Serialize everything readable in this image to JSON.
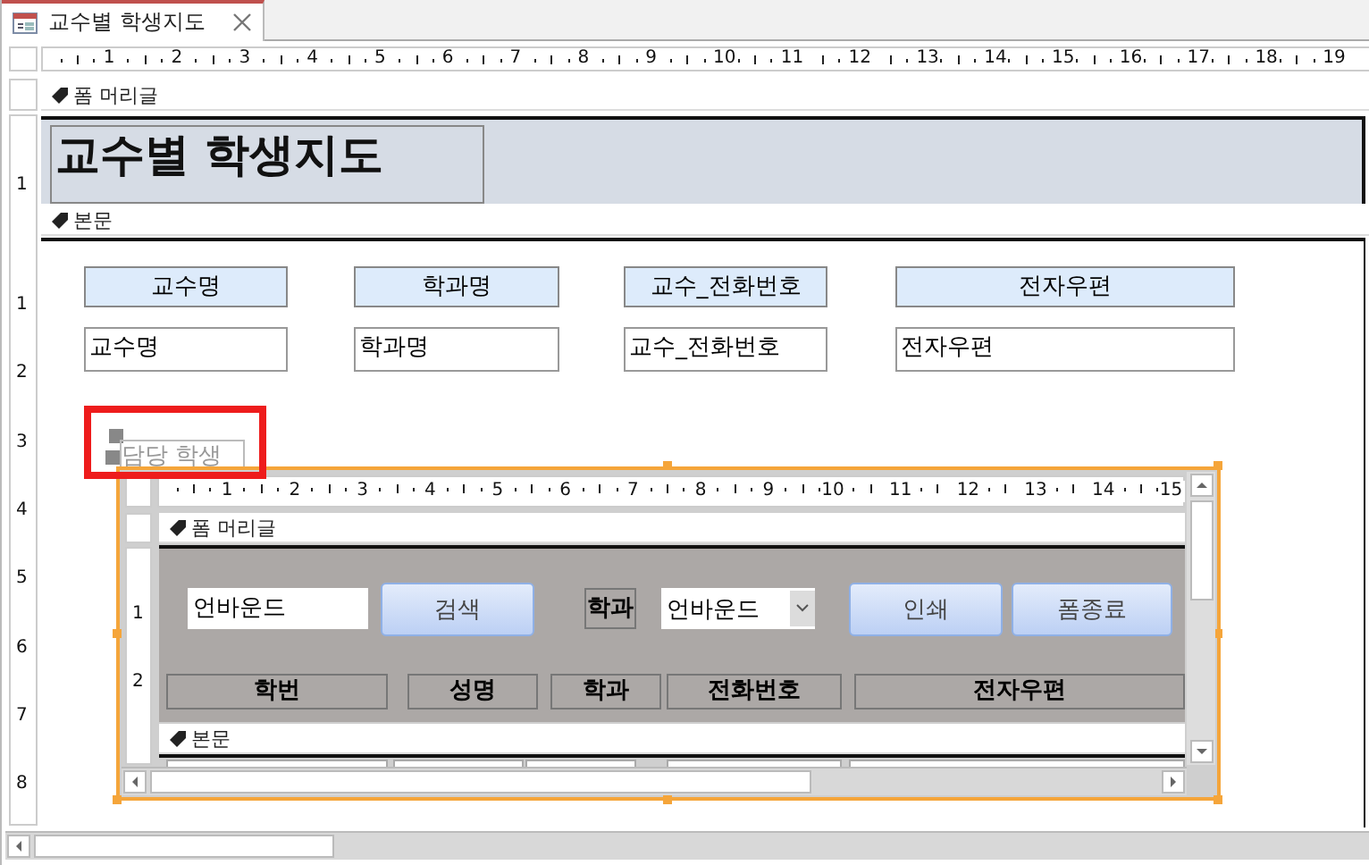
{
  "tab": {
    "title": "교수별 학생지도",
    "selected": true
  },
  "ruler": {
    "marks": [
      "1",
      "2",
      "3",
      "4",
      "5",
      "6",
      "7",
      "8",
      "9",
      "10",
      "11",
      "12",
      "13",
      "14",
      "15",
      "16",
      "17",
      "18",
      "19"
    ]
  },
  "vertical_ruler": {
    "header_marks": [
      "1"
    ],
    "body_marks": [
      "1",
      "2",
      "3",
      "4",
      "5",
      "6",
      "7",
      "8"
    ]
  },
  "form_header": {
    "section_label": "폼 머리글",
    "title": "교수별 학생지도"
  },
  "detail": {
    "section_label": "본문",
    "labels": [
      "교수명",
      "학과명",
      "교수_전화번호",
      "전자우편"
    ],
    "fields": [
      "교수명",
      "학과명",
      "교수_전화번호",
      "전자우편"
    ]
  },
  "subform": {
    "label": "담당 학생",
    "selected": true,
    "ruler_marks": [
      "1",
      "2",
      "3",
      "4",
      "5",
      "6",
      "7",
      "8",
      "9",
      "10",
      "11",
      "12",
      "13",
      "14",
      "15"
    ],
    "vertical_ruler_marks": [
      "1",
      "2"
    ],
    "header": {
      "section_label": "폼 머리글",
      "controls": [
        {
          "kind": "textbox",
          "text": "언바운드"
        },
        {
          "kind": "button",
          "text": "검색"
        },
        {
          "kind": "label",
          "text": "학과"
        },
        {
          "kind": "combo",
          "text": "언바운드"
        },
        {
          "kind": "button",
          "text": "인쇄"
        },
        {
          "kind": "button",
          "text": "폼종료"
        }
      ],
      "column_labels": [
        "학번",
        "성명",
        "학과",
        "전화번호",
        "전자우편"
      ]
    },
    "detail_label": "본문"
  }
}
